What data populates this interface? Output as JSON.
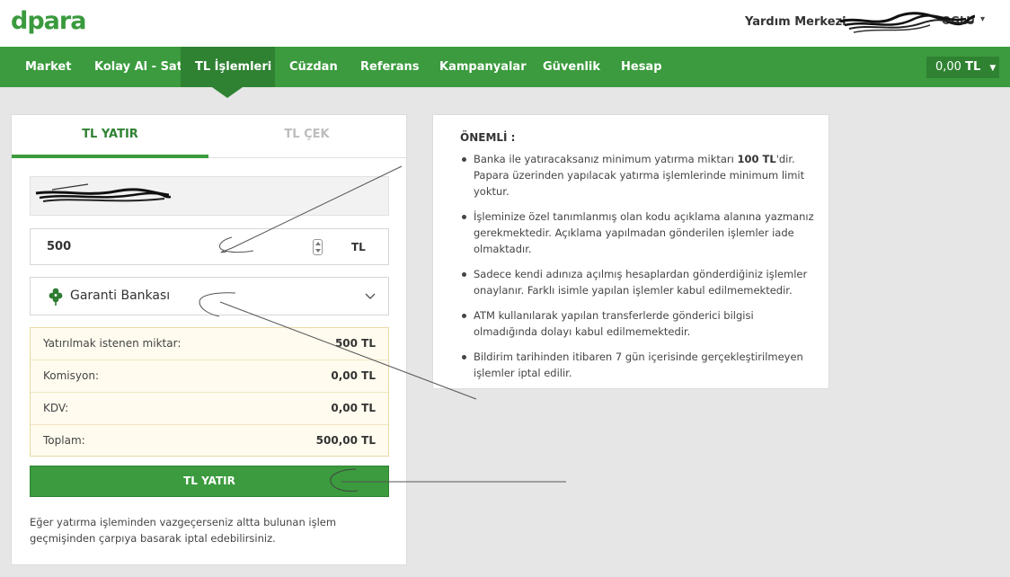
{
  "header": {
    "logo": "dpara",
    "help_link": "Yardım Merkezi",
    "user_name": "OGLU",
    "user_caret": "▾"
  },
  "nav": {
    "items": [
      {
        "label": "Market"
      },
      {
        "label": "Kolay Al - Sat"
      },
      {
        "label": "TL İşlemleri"
      },
      {
        "label": "Cüzdan"
      },
      {
        "label": "Referans"
      },
      {
        "label": "Kampanyalar"
      },
      {
        "label": "Güvenlik"
      },
      {
        "label": "Hesap"
      }
    ],
    "active_index": 2,
    "balance_amount": "0,00",
    "balance_unit": "TL"
  },
  "deposit": {
    "tabs": {
      "deposit": "TL YATIR",
      "withdraw": "TL ÇEK"
    },
    "amount_value": "500",
    "amount_unit": "TL",
    "bank": {
      "name": "Garanti Bankası",
      "icon": "garanti-clover-icon"
    },
    "summary": {
      "requested_label": "Yatırılmak istenen miktar:",
      "requested_value": "500 TL",
      "commission_label": "Komisyon:",
      "commission_value": "0,00 TL",
      "vat_label": "KDV:",
      "vat_value": "0,00 TL",
      "total_label": "Toplam:",
      "total_value": "500,00 TL"
    },
    "submit_label": "TL YATIR",
    "cancel_note": "Eğer yatırma işleminden vazgeçerseniz altta bulunan işlem geçmişinden çarpıya basarak iptal edebilirsiniz."
  },
  "info": {
    "title": "ÖNEMLİ :",
    "items": {
      "min_prefix": "Banka ile yatıracaksanız minimum yatırma miktarı ",
      "min_amount": "100 TL",
      "min_suffix": "'dir. Papara üzerinden yapılacak yatırma işlemlerinde minimum limit yoktur.",
      "code": "İşleminize özel tanımlanmış olan kodu açıklama alanına yazmanız gerekmektedir. Açıklama yapılmadan gönderilen işlemler iade olmaktadır.",
      "own_name": "Sadece kendi adınıza açılmış hesaplardan gönderdiğiniz işlemler onaylanır. Farklı isimle yapılan işlemler kabul edilmemektedir.",
      "atm": "ATM kullanılarak yapılan transferlerde gönderici bilgisi olmadığında dolayı kabul edilmemektedir.",
      "expiry": "Bildirim tarihinden itibaren 7 gün içerisinde gerçekleştirilmeyen işlemler iptal edilir."
    }
  },
  "colors": {
    "brand_green": "#3b9b3e",
    "nav_active": "#2f8232",
    "summary_bg": "#fffbee"
  }
}
